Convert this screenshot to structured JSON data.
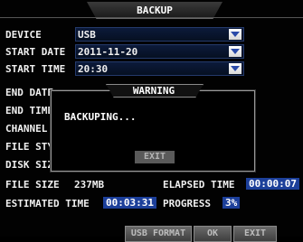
{
  "window": {
    "title": "BACKUP"
  },
  "form": {
    "device_label": "DEVICE",
    "device_value": "USB",
    "start_date_label": "START DATE",
    "start_date_value": "2011-11-20",
    "start_time_label": "START TIME",
    "start_time_value": "20:30",
    "end_date_label": "END DATE",
    "end_time_label": "END TIME",
    "channel_label": "CHANNEL",
    "file_style_label": "FILE STYLE",
    "disk_size_label": "DISK SIZE"
  },
  "status": {
    "file_size_label": "FILE SIZE",
    "file_size_value": "237MB",
    "elapsed_label": "ELAPSED TIME",
    "elapsed_value": "00:00:07",
    "estimated_label": "ESTIMATED TIME",
    "estimated_value": "00:03:31",
    "progress_label": "PROGRESS",
    "progress_value": "3%"
  },
  "dialog": {
    "title": "WARNING",
    "message": "BACKUPING...",
    "button": "EXIT"
  },
  "buttons": {
    "usb_format": "USB FORMAT",
    "ok": "OK",
    "exit": "EXIT"
  },
  "colors": {
    "highlight": "#1c3f9a",
    "background": "#000000"
  }
}
